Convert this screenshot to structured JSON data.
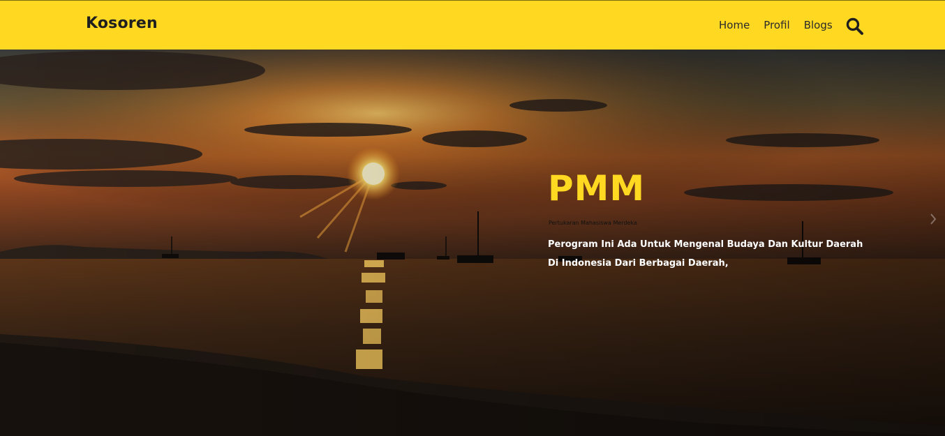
{
  "navbar": {
    "brand": "Kosoren",
    "links": [
      {
        "label": "Home"
      },
      {
        "label": "Profil"
      },
      {
        "label": "Blogs"
      }
    ],
    "search_icon": "search-icon",
    "background": "#ffd821"
  },
  "hero": {
    "title": "PMM",
    "kicker": "Pertukaran Mahasiswa Merdeka",
    "description": "Perogram Ini Ada Untuk Mengenal Budaya Dan Kultur Daerah Di Indonesia Dari Berbagai Daerah,",
    "title_color": "#ffd821",
    "background_image": "sunset-over-sea",
    "next_icon": "chevron-right-icon"
  }
}
